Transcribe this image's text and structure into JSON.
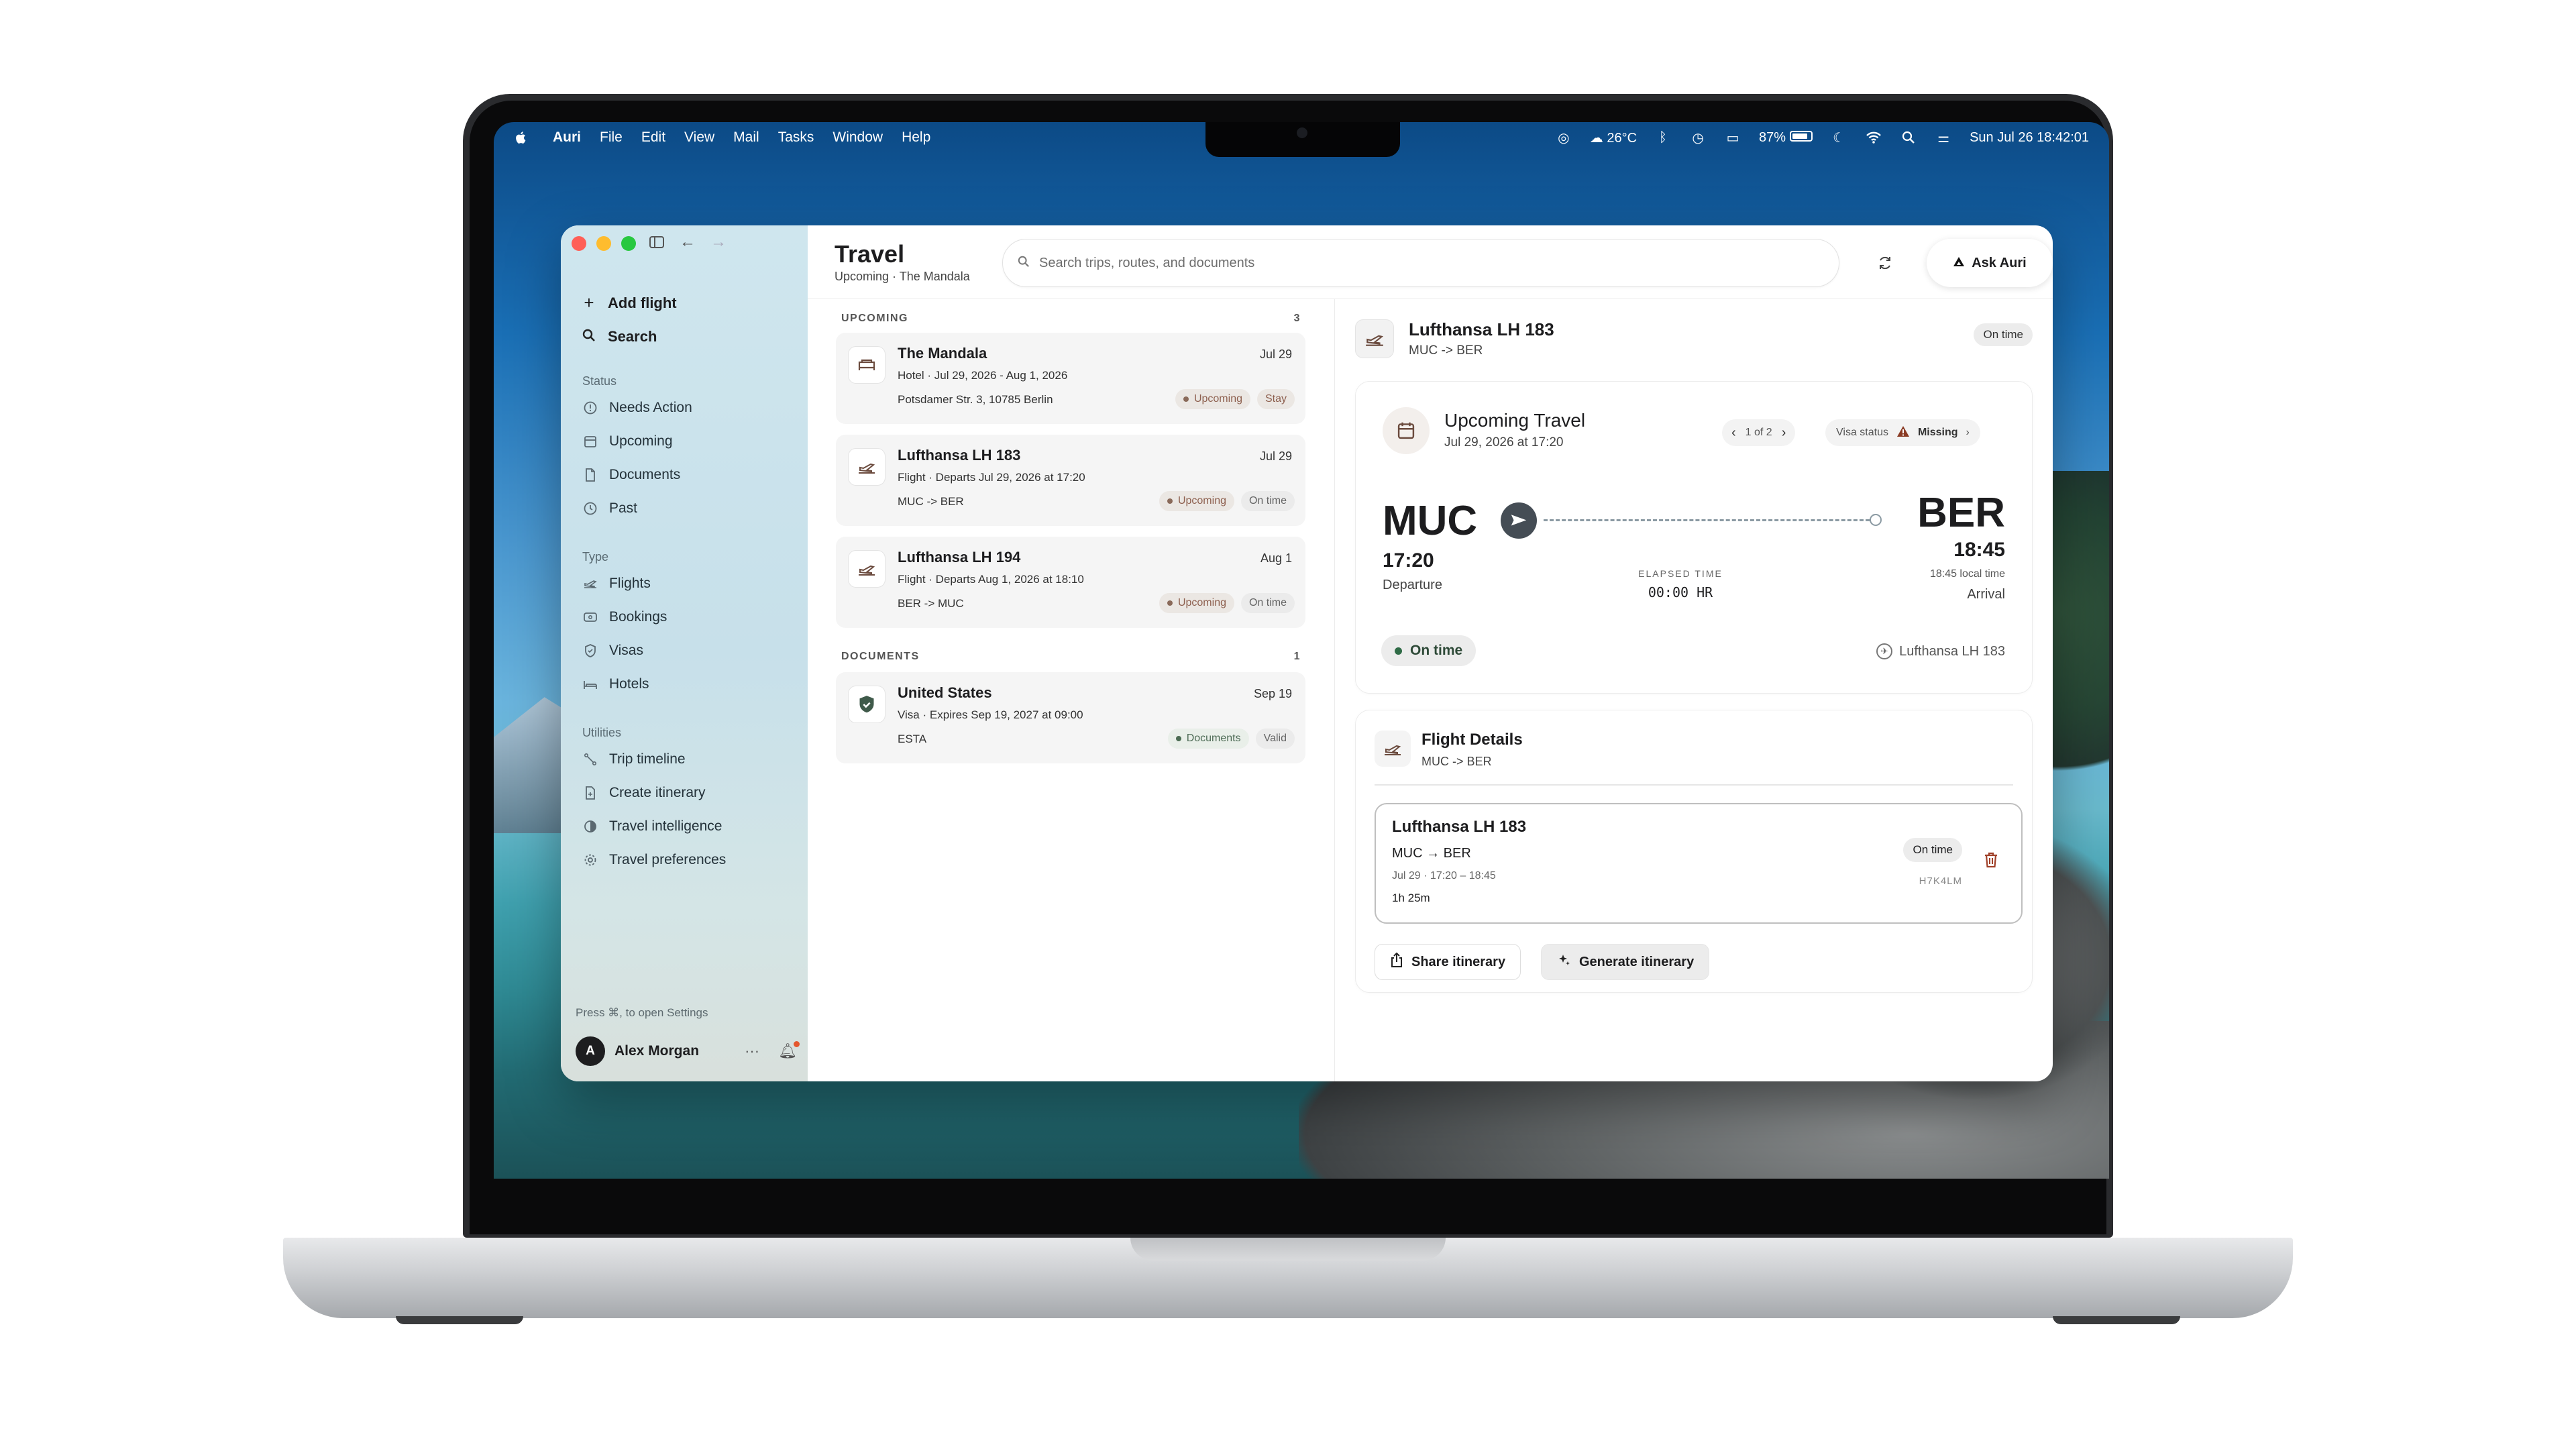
{
  "menubar": {
    "apple": "",
    "app": "Auri",
    "items": [
      "File",
      "Edit",
      "View",
      "Mail",
      "Tasks",
      "Window",
      "Help"
    ],
    "weather": "26°C",
    "battery": "87%",
    "clock": "Sun Jul 26  18:42:01"
  },
  "sidebar": {
    "actions": [
      {
        "label": "Add flight",
        "icon": "plus-icon"
      },
      {
        "label": "Search",
        "icon": "search-icon"
      }
    ],
    "status_header": "Status",
    "status_items": [
      {
        "label": "Needs Action",
        "icon": "alert-circle-icon"
      },
      {
        "label": "Upcoming",
        "icon": "calendar-icon"
      },
      {
        "label": "Documents",
        "icon": "document-icon"
      },
      {
        "label": "Past",
        "icon": "history-icon"
      }
    ],
    "type_header": "Type",
    "type_items": [
      {
        "label": "Flights",
        "icon": "plane-icon"
      },
      {
        "label": "Bookings",
        "icon": "ticket-icon"
      },
      {
        "label": "Visas",
        "icon": "shield-icon"
      },
      {
        "label": "Hotels",
        "icon": "bed-icon"
      }
    ],
    "utilities_header": "Utilities",
    "utility_items": [
      {
        "label": "Trip timeline",
        "icon": "timeline-icon"
      },
      {
        "label": "Create itinerary",
        "icon": "document-add-icon"
      },
      {
        "label": "Travel intelligence",
        "icon": "half-circle-icon"
      },
      {
        "label": "Travel preferences",
        "icon": "gear-icon"
      }
    ],
    "hint": "Press ⌘, to open Settings",
    "user": {
      "initial": "A",
      "name": "Alex Morgan"
    }
  },
  "header": {
    "title": "Travel",
    "subtitle": "Upcoming · The Mandala",
    "search_placeholder": "Search trips, routes, and documents",
    "ask_label": "Ask Auri"
  },
  "list": {
    "upcoming_label": "UPCOMING",
    "upcoming_count": "3",
    "documents_label": "DOCUMENTS",
    "documents_count": "1",
    "cards": [
      {
        "title": "The Mandala",
        "date": "Jul 29",
        "meta": "Hotel · Jul 29, 2026 - Aug 1, 2026",
        "detail": "Potsdamer Str. 3, 10785 Berlin",
        "tags": [
          "Upcoming",
          "Stay"
        ],
        "icon": "bed-icon"
      },
      {
        "title": "Lufthansa LH 183",
        "date": "Jul 29",
        "meta": "Flight · Departs Jul 29, 2026 at 17:20",
        "detail": "MUC -> BER",
        "tags": [
          "Upcoming",
          "On time"
        ],
        "icon": "plane-icon"
      },
      {
        "title": "Lufthansa LH 194",
        "date": "Aug 1",
        "meta": "Flight · Departs Aug 1, 2026 at 18:10",
        "detail": "BER -> MUC",
        "tags": [
          "Upcoming",
          "On time"
        ],
        "icon": "plane-icon"
      },
      {
        "title": "United States",
        "date": "Sep 19",
        "meta": "Visa · Expires Sep 19, 2027 at 09:00",
        "detail": "ESTA",
        "tags": [
          "Documents",
          "Valid"
        ],
        "icon": "shield-check-icon"
      }
    ]
  },
  "detail": {
    "title": "Lufthansa LH 183",
    "route": "MUC -> BER",
    "status": "On time",
    "upcoming": {
      "title": "Upcoming Travel",
      "subtitle": "Jul 29, 2026 at 17:20",
      "pager": "1 of 2",
      "visa_label": "Visa status",
      "visa_value": "Missing",
      "from_code": "MUC",
      "from_time": "17:20",
      "from_label": "Departure",
      "to_code": "BER",
      "to_time": "18:45",
      "to_local": "18:45 local time",
      "to_label": "Arrival",
      "elapsed_label": "ELAPSED TIME",
      "elapsed_value": "00:00 HR",
      "status_pill": "On time",
      "flight_ref": "Lufthansa LH 183"
    },
    "flight_details": {
      "title": "Flight Details",
      "route": "MUC -> BER",
      "card_title": "Lufthansa LH 183",
      "card_route": "MUC → BER",
      "card_time": "Jul 29 · 17:20 – 18:45",
      "card_duration": "1h 25m",
      "card_status": "On time",
      "card_pnr": "H7K4LM",
      "share_label": "Share itinerary",
      "generate_label": "Generate itinerary"
    }
  }
}
